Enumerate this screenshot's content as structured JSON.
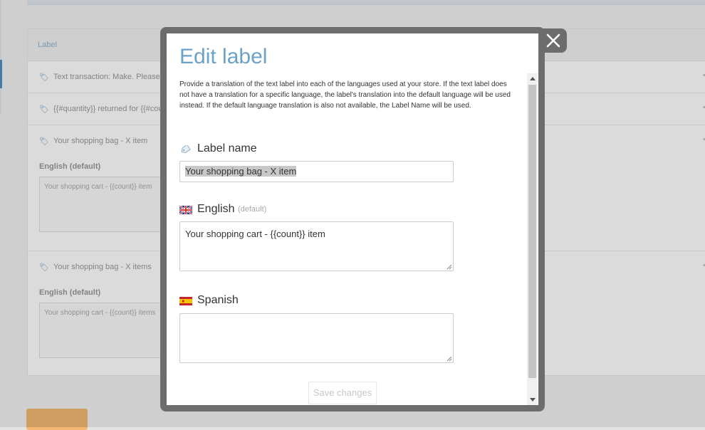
{
  "background": {
    "header_label": "Label",
    "rows": [
      {
        "text": "Text transaction: Make. Please ..."
      },
      {
        "text": "{{#quantity}} returned for {{#count}}"
      },
      {
        "text": "Your shopping bag - X item",
        "lang": "English (default)",
        "value": "Your shopping cart - {{count}} item"
      },
      {
        "text": "Your shopping bag - X items",
        "lang": "English (default)",
        "value": "Your shopping cart - {{count}} items"
      }
    ]
  },
  "modal": {
    "title": "Edit label",
    "description": "Provide a translation of the text label into each of the languages used at your store. If the text label does not have a translation for a specific language, the label's translation into the default language will be used instead. If the default language translation is also not available, the Label Name will be used.",
    "label_name": {
      "label": "Label name",
      "value": "Your shopping bag - X item",
      "icon": "tag-icon"
    },
    "languages": [
      {
        "label": "English",
        "note": "(default)",
        "value": "Your shopping cart - {{count}} item",
        "icon": "flag-uk-icon"
      },
      {
        "label": "Spanish",
        "note": "",
        "value": "",
        "icon": "flag-spain-icon"
      }
    ],
    "save_label": "Save changes",
    "close_icon": "close-icon"
  },
  "colors": {
    "title": "#6aa2c8",
    "frame": "#6d6d6d",
    "orange_button": "#f2b874"
  }
}
